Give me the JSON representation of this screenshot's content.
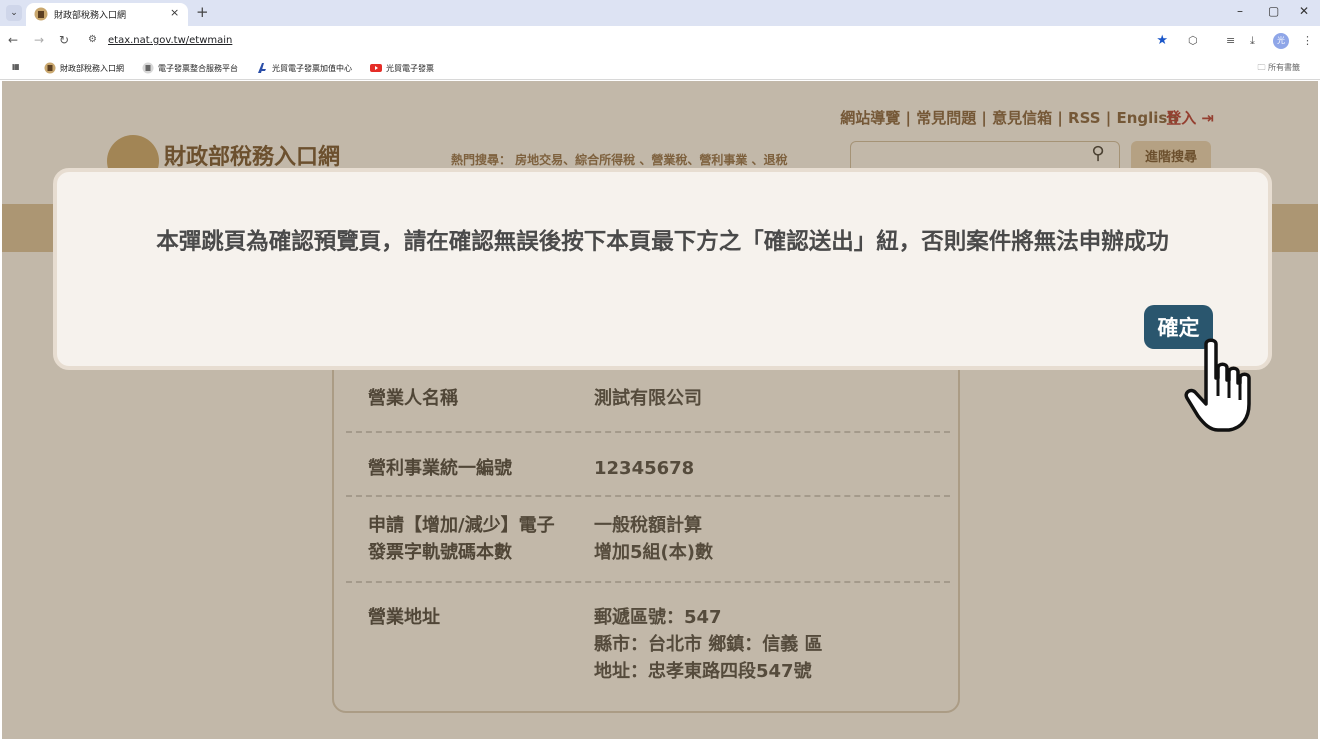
{
  "browser": {
    "tab_title": "財政部稅務入口網",
    "tab_close": "×",
    "new_tab": "+",
    "url": "etax.nat.gov.tw/etwmain",
    "bookmarks": [
      "財政部稅務入口網",
      "電子發票整合服務平台",
      "光貿電子發票加值中心",
      "光貿電子發票"
    ],
    "all_bookmarks": "所有書籤",
    "avatar_text": "光"
  },
  "site": {
    "util_links": "網站導覽 | 常見問題 | 意見信箱 | RSS | English",
    "login": "登入",
    "logo_text": "財政部稅務入口網",
    "hot_search": "熱門搜尋： 房地交易、綜合所得稅 、營業稅、營利事業 、退稅",
    "advanced_search": "進階搜尋"
  },
  "form": {
    "rows": [
      {
        "label": "營業人名稱",
        "value": "測試有限公司"
      },
      {
        "label": "營利事業統一編號",
        "value": "12345678"
      },
      {
        "label_l1": "申請【增加/減少】電子",
        "label_l2": "發票字軌號碼本數",
        "value_l1": "一般稅額計算",
        "value_l2": "增加5組(本)數"
      },
      {
        "label": "營業地址",
        "value_l1": "郵遞區號：547",
        "value_l2": "縣市：台北市 鄉鎮：信義 區",
        "value_l3": "地址：忠孝東路四段547號"
      }
    ]
  },
  "modal": {
    "message": "本彈跳頁為確認預覽頁，請在確認無誤後按下本頁最下方之「確認送出」紐，否則案件將無法申辦成功",
    "ok_label": "確定"
  },
  "colors": {
    "ok_button": "#2a566e",
    "brand_band": "#d9c5a3",
    "login": "#b03030"
  }
}
